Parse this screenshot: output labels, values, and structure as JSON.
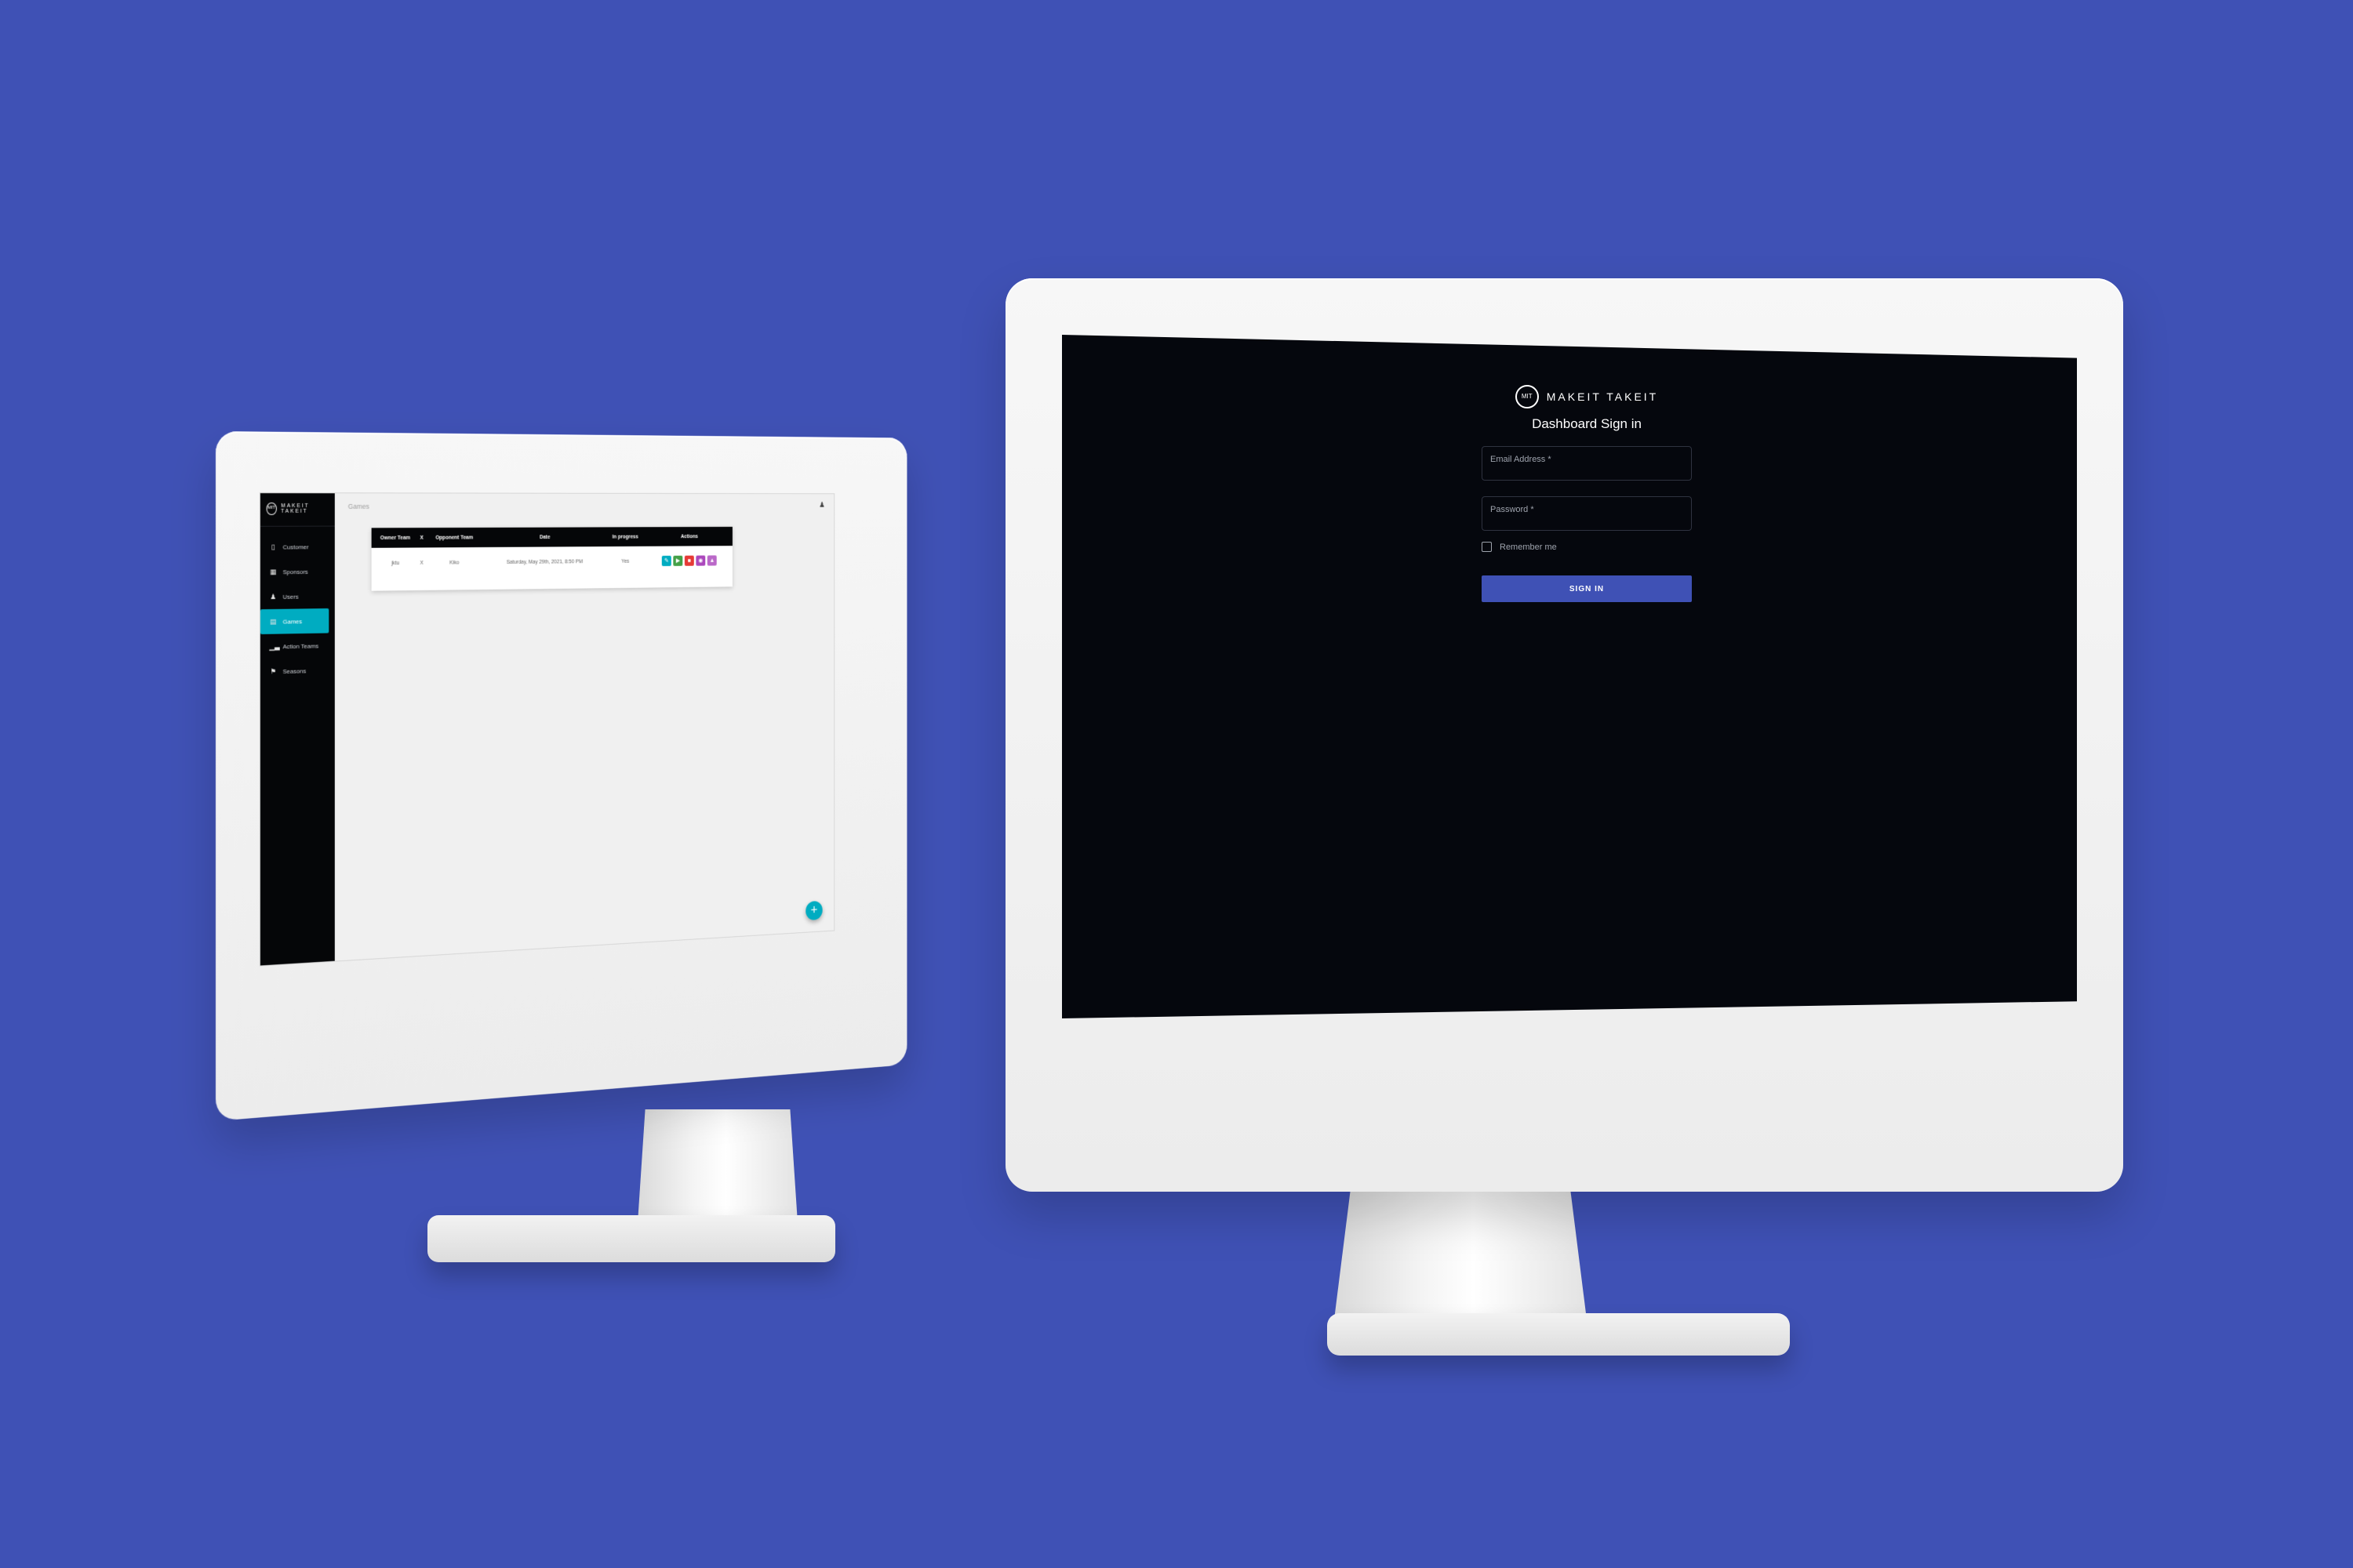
{
  "colors": {
    "background": "#3f51b5",
    "sidebar": "#050608",
    "accent_teal": "#00acc1",
    "primary": "#3f51b5",
    "signin_bg": "#05070d"
  },
  "dashboard": {
    "brand": "MAKEIT TAKEIT",
    "brand_mark": "MIT",
    "breadcrumb": "Games",
    "sidebar": {
      "items": [
        {
          "label": "Customer",
          "icon": "phone-icon"
        },
        {
          "label": "Sponsors",
          "icon": "building-icon"
        },
        {
          "label": "Users",
          "icon": "user-icon"
        },
        {
          "label": "Games",
          "icon": "games-icon",
          "active": true
        },
        {
          "label": "Action Teams",
          "icon": "chart-icon"
        },
        {
          "label": "Seasons",
          "icon": "flag-icon"
        }
      ]
    },
    "table": {
      "headers": [
        "Owner Team",
        "X",
        "Opponent Team",
        "Date",
        "In progress",
        "Actions"
      ],
      "rows": [
        {
          "owner": "jktu",
          "x": "X",
          "opponent": "Kiko",
          "date": "Saturday, May 29th, 2021, 8:50 PM",
          "in_progress": "Yes"
        }
      ],
      "action_buttons": [
        {
          "icon": "edit-icon",
          "color": "#00acc1",
          "glyph": "✎"
        },
        {
          "icon": "play-icon",
          "color": "#43a047",
          "glyph": "▶"
        },
        {
          "icon": "delete-icon",
          "color": "#e53935",
          "glyph": "■"
        },
        {
          "icon": "stats-icon",
          "color": "#ab47bc",
          "glyph": "◉"
        },
        {
          "icon": "team-icon",
          "color": "#ba68c8",
          "glyph": "▲"
        }
      ]
    },
    "fab": "+"
  },
  "signin": {
    "brand": "MAKEIT TAKEIT",
    "brand_mark": "MIT",
    "title": "Dashboard Sign in",
    "email_label": "Email Address *",
    "password_label": "Password *",
    "remember_label": "Remember me",
    "button_label": "SIGN IN"
  }
}
